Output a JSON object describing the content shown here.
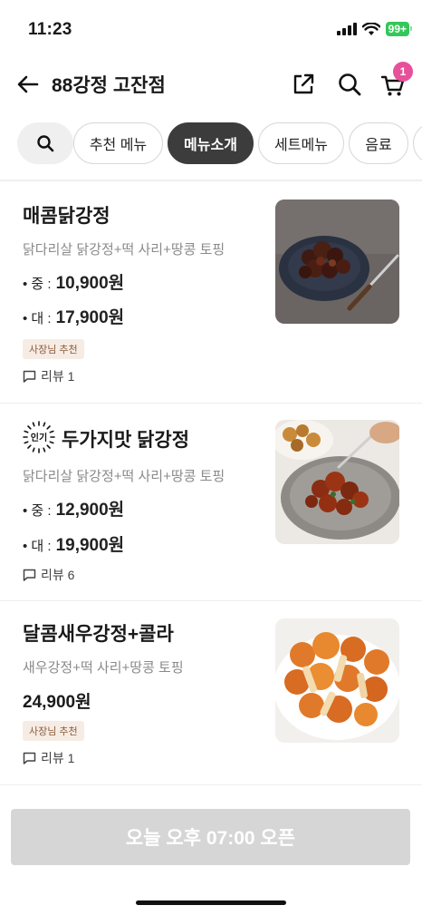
{
  "status": {
    "time": "11:23",
    "battery": "99+"
  },
  "header": {
    "title": "88강정 고잔점",
    "cart_count": "1"
  },
  "tabs": [
    {
      "label": "추천 메뉴",
      "active": false
    },
    {
      "label": "메뉴소개",
      "active": true
    },
    {
      "label": "세트메뉴",
      "active": false
    },
    {
      "label": "음료",
      "active": false
    }
  ],
  "menu": [
    {
      "name": "매콤닭강정",
      "desc": "닭다리살 닭강정+떡 사리+땅콩 토핑",
      "prices": [
        {
          "size": "• 중 :",
          "amount": "10,900원"
        },
        {
          "size": "• 대 :",
          "amount": "17,900원"
        }
      ],
      "badge": "사장님 추천",
      "review": "리뷰 1"
    },
    {
      "popular": "인기",
      "name": "두가지맛 닭강정",
      "desc": "닭다리살 닭강정+떡 사리+땅콩 토핑",
      "prices": [
        {
          "size": "• 중 :",
          "amount": "12,900원"
        },
        {
          "size": "• 대 :",
          "amount": "19,900원"
        }
      ],
      "review": "리뷰 6"
    },
    {
      "name": "달콤새우강정+콜라",
      "desc": "새우강정+떡 사리+땅콩 토핑",
      "price": "24,900원",
      "badge": "사장님 추천",
      "review": "리뷰 1"
    }
  ],
  "footer": {
    "open_label": "오늘 오후 07:00 오픈"
  },
  "icons": [
    "back-arrow-icon",
    "share-icon",
    "search-icon",
    "cart-icon",
    "comment-icon"
  ],
  "colors": {
    "accent_badge": "#e6519a",
    "active_tab": "#3c3c3c",
    "battery": "#34c759",
    "owner_badge_bg": "#f6ece4"
  }
}
